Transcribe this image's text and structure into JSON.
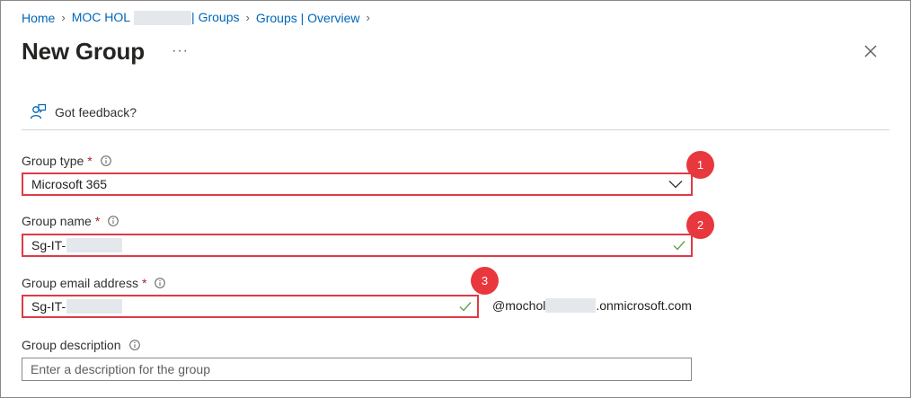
{
  "breadcrumb": {
    "home": "Home",
    "tenant_prefix": "MOC HOL",
    "tenant_suffix": "| Groups",
    "overview": "Groups | Overview"
  },
  "page": {
    "title": "New Group",
    "more": "···"
  },
  "toolbar": {
    "feedback_label": "Got feedback?"
  },
  "form": {
    "group_type": {
      "label": "Group type",
      "required": "*",
      "value": "Microsoft 365"
    },
    "group_name": {
      "label": "Group name",
      "required": "*",
      "value": "Sg-IT-"
    },
    "group_email": {
      "label": "Group email address",
      "required": "*",
      "value": "Sg-IT-",
      "domain_prefix": "@mochol",
      "domain_suffix": ".onmicrosoft.com"
    },
    "group_description": {
      "label": "Group description",
      "placeholder": "Enter a description for the group",
      "value": ""
    }
  },
  "callouts": [
    "1",
    "2",
    "3"
  ],
  "colors": {
    "link": "#0066b8",
    "highlight": "#de3b46",
    "badge": "#e8383d",
    "valid": "#5ea34c",
    "required": "#a4262c"
  }
}
